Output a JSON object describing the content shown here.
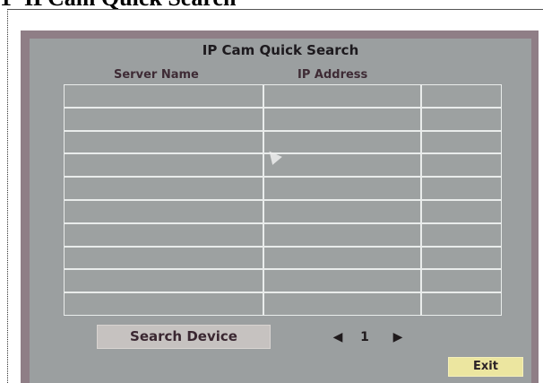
{
  "doc_heading": {
    "number": "1",
    "text": "IPCam Quick Search"
  },
  "dialog": {
    "title": "IP Cam Quick Search",
    "columns": [
      "Server Name",
      "IP Address",
      ""
    ],
    "rows": [
      [
        "",
        "",
        ""
      ],
      [
        "",
        "",
        ""
      ],
      [
        "",
        "",
        ""
      ],
      [
        "",
        "",
        ""
      ],
      [
        "",
        "",
        ""
      ],
      [
        "",
        "",
        ""
      ],
      [
        "",
        "",
        ""
      ],
      [
        "",
        "",
        ""
      ],
      [
        "",
        "",
        ""
      ],
      [
        "",
        "",
        ""
      ]
    ],
    "search_button": "Search Device",
    "pager": {
      "prev_icon": "triangle-left",
      "page": "1",
      "next_icon": "triangle-right"
    },
    "exit_button": "Exit"
  },
  "colors": {
    "outer_border": "#8f7e86",
    "panel": "#9b9fa0",
    "grid_lines": "#e9eceb",
    "button": "#c6c2c0",
    "exit_button": "#ece6a0"
  }
}
